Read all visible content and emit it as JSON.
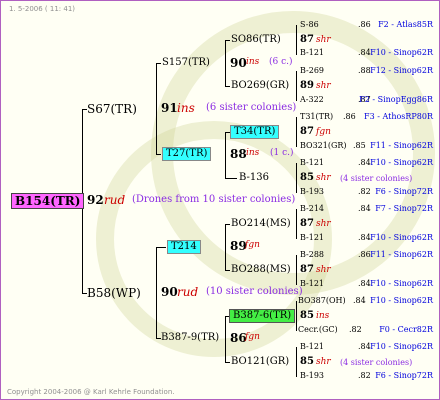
{
  "header": "1. 5-2006 ( 11: 41)",
  "footer": "Copyright 2004-2006 @ Karl Kehrle Foundation.",
  "colors": {
    "root_highlight": "#ff66ff",
    "cyan_highlight": "#33ffff",
    "green_highlight": "#44ee44",
    "insemination": "#cc0000",
    "note": "#8a2be2",
    "source": "#0000dd"
  },
  "root": {
    "name": "B154(TR)",
    "year": "92",
    "ins": "rud",
    "note": "(Drones from 10 sister colonies)"
  },
  "queen": {
    "name": "S67(TR)",
    "year": "91",
    "ins": "ins",
    "note": "(6 sister colonies)"
  },
  "drone": {
    "name": "B58(WP)",
    "year": "90",
    "ins": "rud",
    "note": "(10 sister colonies)"
  },
  "q1": {
    "name": "S157(TR)",
    "year": "90",
    "ins": "ins",
    "note": "(6 c.)"
  },
  "q2": {
    "name": "T27(TR)",
    "year": "88",
    "ins": "ins",
    "note": "(1 c.)"
  },
  "d1": {
    "name": "T214",
    "year": "89",
    "ins": "fgn"
  },
  "d2": {
    "name": "B387-9(TR)",
    "year": "86",
    "ins": "fgn"
  },
  "g1": {
    "name": "SO86(TR)",
    "year": "87",
    "ins": "shr"
  },
  "g2": {
    "name": "BO269(GR)",
    "year": "89",
    "ins": "shr"
  },
  "g3": {
    "name": "T34(TR)",
    "year": "87",
    "ins": "fgn"
  },
  "g4": {
    "name": "B-136",
    "year": "85",
    "ins": "shr",
    "note": "(4 sister colonies)"
  },
  "g5": {
    "name": "BO214(MS)",
    "year": "87",
    "ins": "shr"
  },
  "g6": {
    "name": "BO288(MS)",
    "year": "87",
    "ins": "shr"
  },
  "g7": {
    "name": "B387-6(TR)",
    "year": "85",
    "ins": "ins"
  },
  "g8": {
    "name": "BO121(GR)",
    "year": "85",
    "ins": "shr",
    "note": "(4 sister colonies)"
  },
  "l1": {
    "name": "S-86",
    "yr": ".86",
    "src": "F2 - Atlas85R"
  },
  "l2": {
    "name": "B-121",
    "yr": ".84",
    "src": "F10 - Sinop62R"
  },
  "l3": {
    "name": "B-269",
    "yr": ".88",
    "src": "F12 - Sinop62R"
  },
  "l4": {
    "name": "A-322",
    "yr": ".87",
    "src": "F2 - SinopEgg86R"
  },
  "l5": {
    "name": "T31(TR)",
    "yr": ".86",
    "src": "F3 - AthosRP80R"
  },
  "l6": {
    "name": "BO321(GR)",
    "yr": ".85",
    "src": "F11 - Sinop62R"
  },
  "l7": {
    "name": "B-121",
    "yr": ".84",
    "src": "F10 - Sinop62R"
  },
  "l8": {
    "name": "B-193",
    "yr": ".82",
    "src": "F6 - Sinop72R"
  },
  "l9": {
    "name": "B-214",
    "yr": ".84",
    "src": "F7 - Sinop72R"
  },
  "l10": {
    "name": "B-121",
    "yr": ".84",
    "src": "F10 - Sinop62R"
  },
  "l11": {
    "name": "B-288",
    "yr": ".86",
    "src": "F11 - Sinop62R"
  },
  "l12": {
    "name": "B-121",
    "yr": ".84",
    "src": "F10 - Sinop62R"
  },
  "l13": {
    "name": "BO387(OH)",
    "yr": ".84",
    "src": "F10 - Sinop62R"
  },
  "l14": {
    "name": "Cecr.(GC)",
    "yr": ".82",
    "src": "F0 - Cecr82R"
  },
  "l15": {
    "name": "B-121",
    "yr": ".84",
    "src": "F10 - Sinop62R"
  },
  "l16": {
    "name": "B-193",
    "yr": ".82",
    "src": "F6 - Sinop72R"
  }
}
